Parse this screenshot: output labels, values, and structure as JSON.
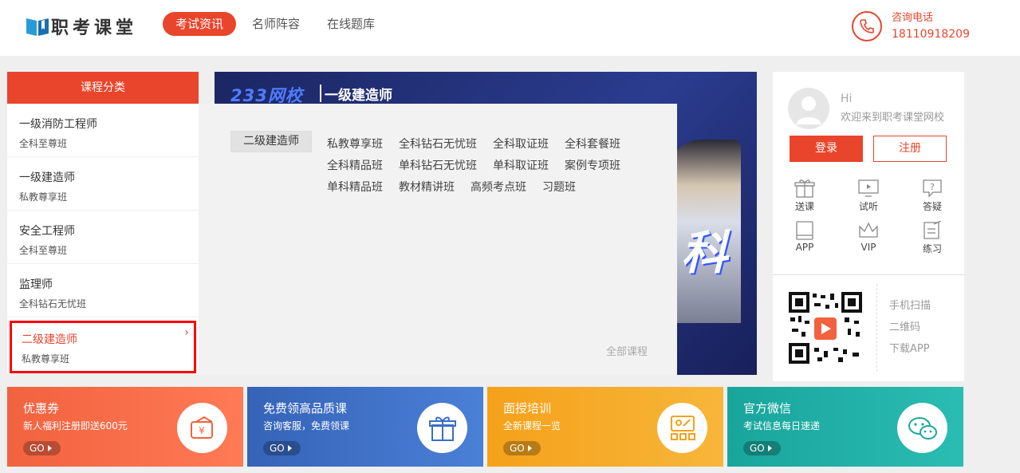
{
  "header": {
    "logo_text": "职考课堂",
    "nav": [
      {
        "label": "考试资讯",
        "active": true
      },
      {
        "label": "名师阵容",
        "active": false
      },
      {
        "label": "在线题库",
        "active": false
      }
    ],
    "phone_label": "咨询电话",
    "phone_number": "18110918209"
  },
  "categories": {
    "title": "课程分类",
    "items": [
      {
        "title": "一级消防工程师",
        "sub": "全科至尊班"
      },
      {
        "title": "一级建造师",
        "sub": "私教尊享班"
      },
      {
        "title": "安全工程师",
        "sub": "全科至尊班"
      },
      {
        "title": "监理师",
        "sub": "全科钻石无忧班"
      },
      {
        "title": "二级建造师",
        "sub": "私教尊享班",
        "selected": true,
        "arrow": "›"
      }
    ]
  },
  "banner": {
    "brand": "233网校",
    "title": "一级建造师",
    "big_text": "科"
  },
  "popup": {
    "category": "二级建造师",
    "links": [
      "私教尊享班",
      "全科钻石无忧班",
      "全科取证班",
      "全科套餐班",
      "全科精品班",
      "单科钻石无忧班",
      "单科取证班",
      "案例专项班",
      "单科精品班",
      "教材精讲班",
      "高频考点班",
      "习题班"
    ],
    "all_label": "全部课程"
  },
  "user": {
    "hi": "Hi",
    "welcome": "欢迎来到职考课堂网校",
    "login": "登录",
    "register": "注册",
    "shortcuts": [
      {
        "label": "送课",
        "icon": "gift-icon"
      },
      {
        "label": "试听",
        "icon": "monitor-icon"
      },
      {
        "label": "答疑",
        "icon": "question-icon"
      },
      {
        "label": "APP",
        "icon": "tablet-icon"
      },
      {
        "label": "VIP",
        "icon": "crown-icon"
      },
      {
        "label": "练习",
        "icon": "exercise-icon"
      }
    ],
    "qr_lines": [
      "手机扫描",
      "二维码",
      "下载APP"
    ]
  },
  "cards": [
    {
      "title": "优惠券",
      "sub": "新人福利注册即送600元",
      "go": "GO",
      "color": "#f2623f",
      "icon": "coupon-icon"
    },
    {
      "title": "免费领高品质课",
      "sub": "咨询客服，免费领课",
      "go": "GO",
      "color": "#3a6fc4",
      "icon": "gift-box-icon"
    },
    {
      "title": "面授培训",
      "sub": "全新课程一览",
      "go": "GO",
      "color": "#f5a11a",
      "icon": "training-icon"
    },
    {
      "title": "官方微信",
      "sub": "考试信息每日速递",
      "go": "GO",
      "color": "#1aa99f",
      "icon": "wechat-icon"
    }
  ],
  "colors": {
    "accent": "#e8452c"
  }
}
